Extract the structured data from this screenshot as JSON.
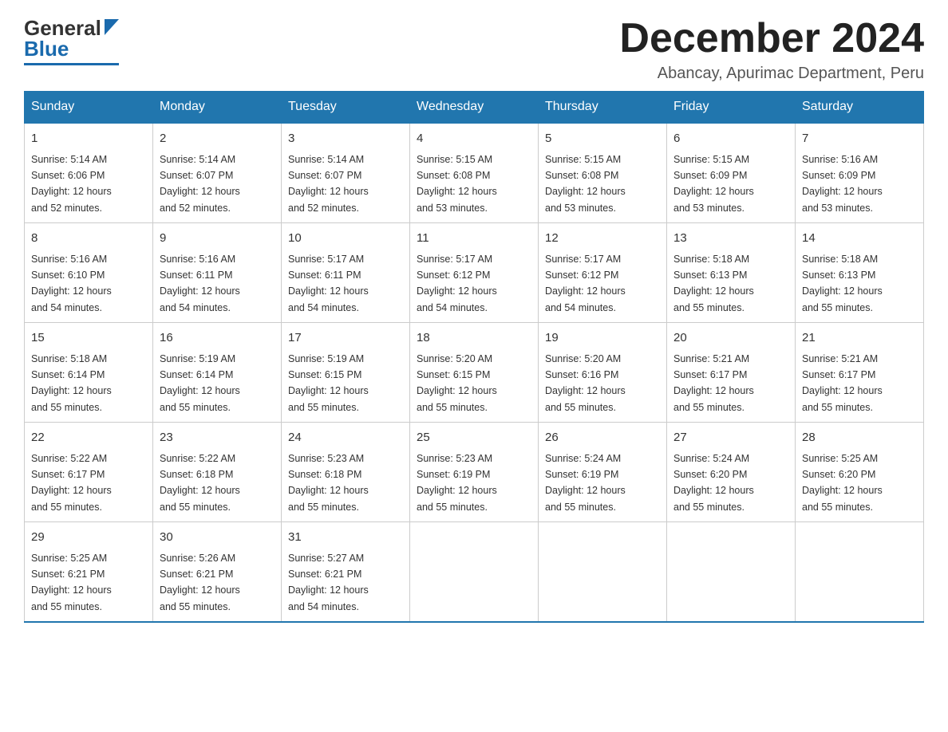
{
  "header": {
    "logo_general": "General",
    "logo_blue": "Blue",
    "month_title": "December 2024",
    "location": "Abancay, Apurimac Department, Peru"
  },
  "weekdays": [
    "Sunday",
    "Monday",
    "Tuesday",
    "Wednesday",
    "Thursday",
    "Friday",
    "Saturday"
  ],
  "weeks": [
    [
      {
        "day": "1",
        "sunrise": "5:14 AM",
        "sunset": "6:06 PM",
        "daylight": "12 hours and 52 minutes."
      },
      {
        "day": "2",
        "sunrise": "5:14 AM",
        "sunset": "6:07 PM",
        "daylight": "12 hours and 52 minutes."
      },
      {
        "day": "3",
        "sunrise": "5:14 AM",
        "sunset": "6:07 PM",
        "daylight": "12 hours and 52 minutes."
      },
      {
        "day": "4",
        "sunrise": "5:15 AM",
        "sunset": "6:08 PM",
        "daylight": "12 hours and 53 minutes."
      },
      {
        "day": "5",
        "sunrise": "5:15 AM",
        "sunset": "6:08 PM",
        "daylight": "12 hours and 53 minutes."
      },
      {
        "day": "6",
        "sunrise": "5:15 AM",
        "sunset": "6:09 PM",
        "daylight": "12 hours and 53 minutes."
      },
      {
        "day": "7",
        "sunrise": "5:16 AM",
        "sunset": "6:09 PM",
        "daylight": "12 hours and 53 minutes."
      }
    ],
    [
      {
        "day": "8",
        "sunrise": "5:16 AM",
        "sunset": "6:10 PM",
        "daylight": "12 hours and 54 minutes."
      },
      {
        "day": "9",
        "sunrise": "5:16 AM",
        "sunset": "6:11 PM",
        "daylight": "12 hours and 54 minutes."
      },
      {
        "day": "10",
        "sunrise": "5:17 AM",
        "sunset": "6:11 PM",
        "daylight": "12 hours and 54 minutes."
      },
      {
        "day": "11",
        "sunrise": "5:17 AM",
        "sunset": "6:12 PM",
        "daylight": "12 hours and 54 minutes."
      },
      {
        "day": "12",
        "sunrise": "5:17 AM",
        "sunset": "6:12 PM",
        "daylight": "12 hours and 54 minutes."
      },
      {
        "day": "13",
        "sunrise": "5:18 AM",
        "sunset": "6:13 PM",
        "daylight": "12 hours and 55 minutes."
      },
      {
        "day": "14",
        "sunrise": "5:18 AM",
        "sunset": "6:13 PM",
        "daylight": "12 hours and 55 minutes."
      }
    ],
    [
      {
        "day": "15",
        "sunrise": "5:18 AM",
        "sunset": "6:14 PM",
        "daylight": "12 hours and 55 minutes."
      },
      {
        "day": "16",
        "sunrise": "5:19 AM",
        "sunset": "6:14 PM",
        "daylight": "12 hours and 55 minutes."
      },
      {
        "day": "17",
        "sunrise": "5:19 AM",
        "sunset": "6:15 PM",
        "daylight": "12 hours and 55 minutes."
      },
      {
        "day": "18",
        "sunrise": "5:20 AM",
        "sunset": "6:15 PM",
        "daylight": "12 hours and 55 minutes."
      },
      {
        "day": "19",
        "sunrise": "5:20 AM",
        "sunset": "6:16 PM",
        "daylight": "12 hours and 55 minutes."
      },
      {
        "day": "20",
        "sunrise": "5:21 AM",
        "sunset": "6:17 PM",
        "daylight": "12 hours and 55 minutes."
      },
      {
        "day": "21",
        "sunrise": "5:21 AM",
        "sunset": "6:17 PM",
        "daylight": "12 hours and 55 minutes."
      }
    ],
    [
      {
        "day": "22",
        "sunrise": "5:22 AM",
        "sunset": "6:17 PM",
        "daylight": "12 hours and 55 minutes."
      },
      {
        "day": "23",
        "sunrise": "5:22 AM",
        "sunset": "6:18 PM",
        "daylight": "12 hours and 55 minutes."
      },
      {
        "day": "24",
        "sunrise": "5:23 AM",
        "sunset": "6:18 PM",
        "daylight": "12 hours and 55 minutes."
      },
      {
        "day": "25",
        "sunrise": "5:23 AM",
        "sunset": "6:19 PM",
        "daylight": "12 hours and 55 minutes."
      },
      {
        "day": "26",
        "sunrise": "5:24 AM",
        "sunset": "6:19 PM",
        "daylight": "12 hours and 55 minutes."
      },
      {
        "day": "27",
        "sunrise": "5:24 AM",
        "sunset": "6:20 PM",
        "daylight": "12 hours and 55 minutes."
      },
      {
        "day": "28",
        "sunrise": "5:25 AM",
        "sunset": "6:20 PM",
        "daylight": "12 hours and 55 minutes."
      }
    ],
    [
      {
        "day": "29",
        "sunrise": "5:25 AM",
        "sunset": "6:21 PM",
        "daylight": "12 hours and 55 minutes."
      },
      {
        "day": "30",
        "sunrise": "5:26 AM",
        "sunset": "6:21 PM",
        "daylight": "12 hours and 55 minutes."
      },
      {
        "day": "31",
        "sunrise": "5:27 AM",
        "sunset": "6:21 PM",
        "daylight": "12 hours and 54 minutes."
      },
      null,
      null,
      null,
      null
    ]
  ],
  "labels": {
    "sunrise": "Sunrise:",
    "sunset": "Sunset:",
    "daylight": "Daylight:"
  }
}
